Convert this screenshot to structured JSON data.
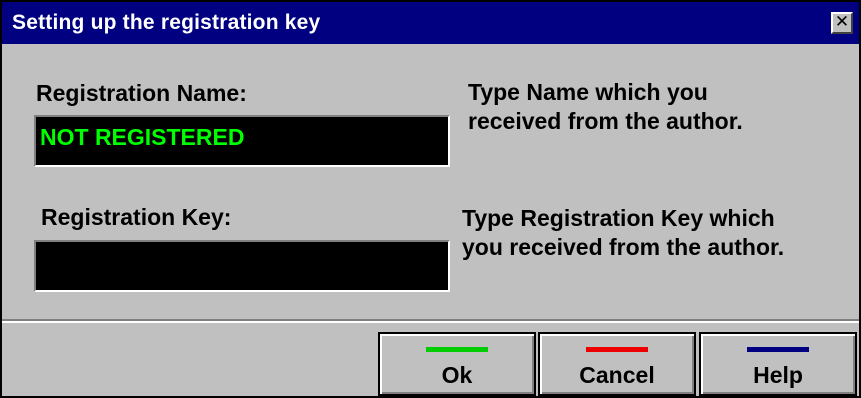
{
  "window": {
    "title": "Setting up the registration key",
    "close_glyph": "✕",
    "colors": {
      "titlebar": "#000080",
      "face": "#c0c0c0",
      "field_bg": "#000000",
      "field_text": "#00ff00"
    }
  },
  "form": {
    "name_label": "Registration Name:",
    "name_value": "NOT REGISTERED",
    "name_help_line1": "Type Name which you",
    "name_help_line2": "received from the author.",
    "key_label": "Registration Key:",
    "key_value": "",
    "key_help_line1": "Type Registration Key which",
    "key_help_line2": "you received from the author."
  },
  "buttons": {
    "ok": {
      "label": "Ok",
      "bar_color": "#00cc00"
    },
    "cancel": {
      "label": "Cancel",
      "bar_color": "#ee0000"
    },
    "help": {
      "label": "Help",
      "bar_color": "#000080"
    }
  }
}
